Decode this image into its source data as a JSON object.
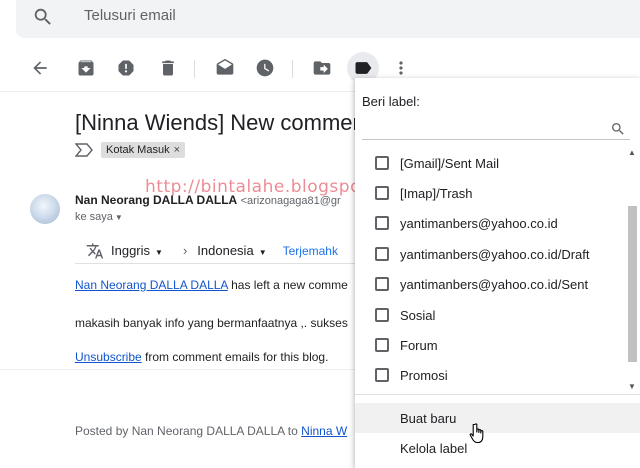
{
  "search": {
    "placeholder": "Telusuri email",
    "icon": "search-icon"
  },
  "toolbar": {
    "buttons": [
      {
        "name": "back",
        "icon": "arrow-left-icon"
      },
      {
        "name": "archive",
        "icon": "archive-icon"
      },
      {
        "name": "report-spam",
        "icon": "report-icon"
      },
      {
        "name": "delete",
        "icon": "trash-icon"
      },
      {
        "name": "mark-unread",
        "icon": "mail-open-icon"
      },
      {
        "name": "snooze",
        "icon": "clock-icon"
      },
      {
        "name": "move-to",
        "icon": "move-folder-icon"
      },
      {
        "name": "labels",
        "icon": "label-icon",
        "active": true
      },
      {
        "name": "more",
        "icon": "more-vert-icon"
      }
    ]
  },
  "email": {
    "subject": "[Ninna Wiends] New comment",
    "label_chip": "Kotak Masuk",
    "label_chip_close": "×",
    "sender_name": "Nan Neorang DALLA DALLA",
    "sender_address": "<arizonagaga81@gr",
    "to_line": "ke saya",
    "translate": {
      "from_lang": "Inggris",
      "to_lang": "Indonesia",
      "action": "Terjemahk"
    },
    "body_link_name": "Nan Neorang DALLA DALLA",
    "body_line1_rest": " has left a new comme",
    "body_line2": "makasih banyak info yang bermanfaatnya ,. sukses",
    "unsubscribe": "Unsubscribe",
    "unsubscribe_rest": " from comment emails for this blog.",
    "footer_prefix": "Posted by Nan Neorang DALLA DALLA to ",
    "footer_link": "Ninna W"
  },
  "watermark": "http://bintalahe.blogspot.com/",
  "label_menu": {
    "title": "Beri label:",
    "search_icon": "search-icon",
    "items": [
      {
        "label": "[Gmail]/Sent Mail",
        "checked": false
      },
      {
        "label": "[Imap]/Trash",
        "checked": false
      },
      {
        "label": "yantimanbers@yahoo.co.id",
        "checked": false
      },
      {
        "label": "yantimanbers@yahoo.co.id/Draft",
        "checked": false
      },
      {
        "label": "yantimanbers@yahoo.co.id/Sent",
        "checked": false
      },
      {
        "label": "Sosial",
        "checked": false
      },
      {
        "label": "Forum",
        "checked": false
      },
      {
        "label": "Promosi",
        "checked": false
      }
    ],
    "create_new": "Buat baru",
    "manage": "Kelola label"
  }
}
